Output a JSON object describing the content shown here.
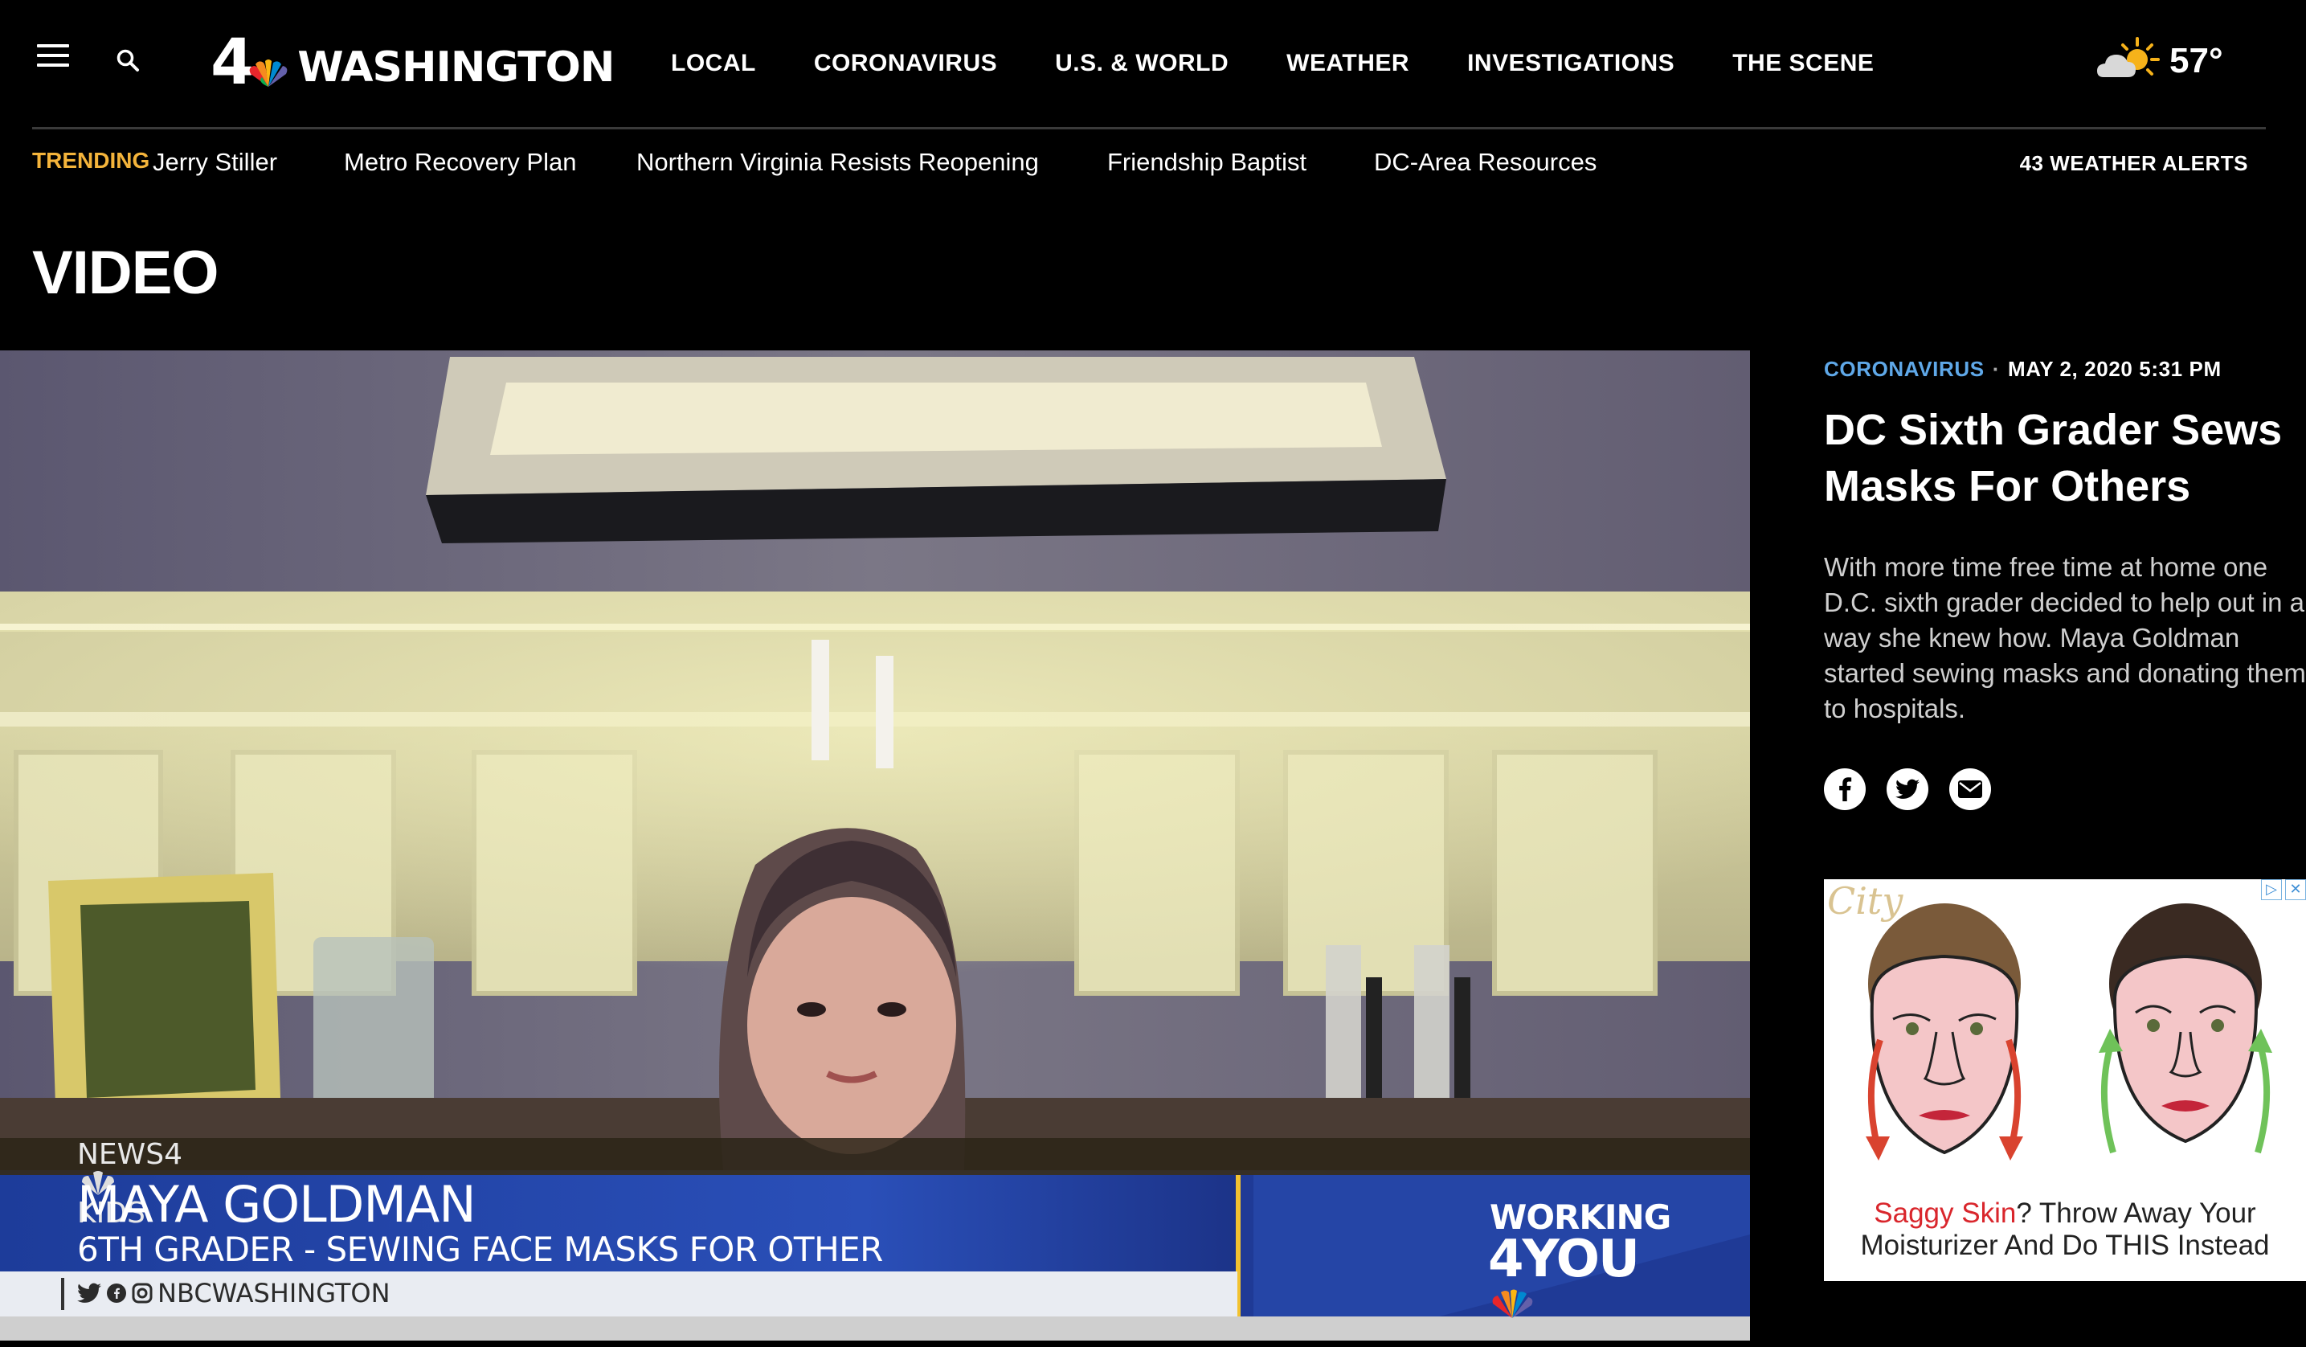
{
  "header": {
    "logo_number": "4",
    "logo_text": "WASHINGTON",
    "nav": [
      "LOCAL",
      "CORONAVIRUS",
      "U.S. & WORLD",
      "WEATHER",
      "INVESTIGATIONS",
      "THE SCENE"
    ],
    "weather_temp": "57°"
  },
  "trending": {
    "label": "TRENDING",
    "items": [
      "Jerry Stiller",
      "Metro Recovery Plan",
      "Northern Virginia Resists Reopening",
      "Friendship Baptist",
      "DC-Area Resources"
    ],
    "alerts": "43 WEATHER ALERTS"
  },
  "page_title": "VIDEO",
  "video": {
    "tag": "NEWS4",
    "tag_suffix": "KIDS",
    "name": "MAYA GOLDMAN",
    "subtitle": "6TH GRADER - SEWING FACE MASKS FOR OTHER",
    "social": "NBCWASHINGTON",
    "brand_line1": "WORKING",
    "brand_line2": "4YOU"
  },
  "article": {
    "category": "CORONAVIRUS",
    "separator": "·",
    "date": "MAY 2, 2020 5:31 PM",
    "headline": "DC Sixth Grader Sews Masks For Others",
    "summary": "With more time free time at home one D.C. sixth grader decided to help out in a way she knew how. Maya Goldman started sewing masks and donating them to hospitals."
  },
  "ad": {
    "brand": "City",
    "text_highlight": "Saggy Skin",
    "text_rest": "? Throw Away Your Moisturizer And Do THIS Instead"
  }
}
